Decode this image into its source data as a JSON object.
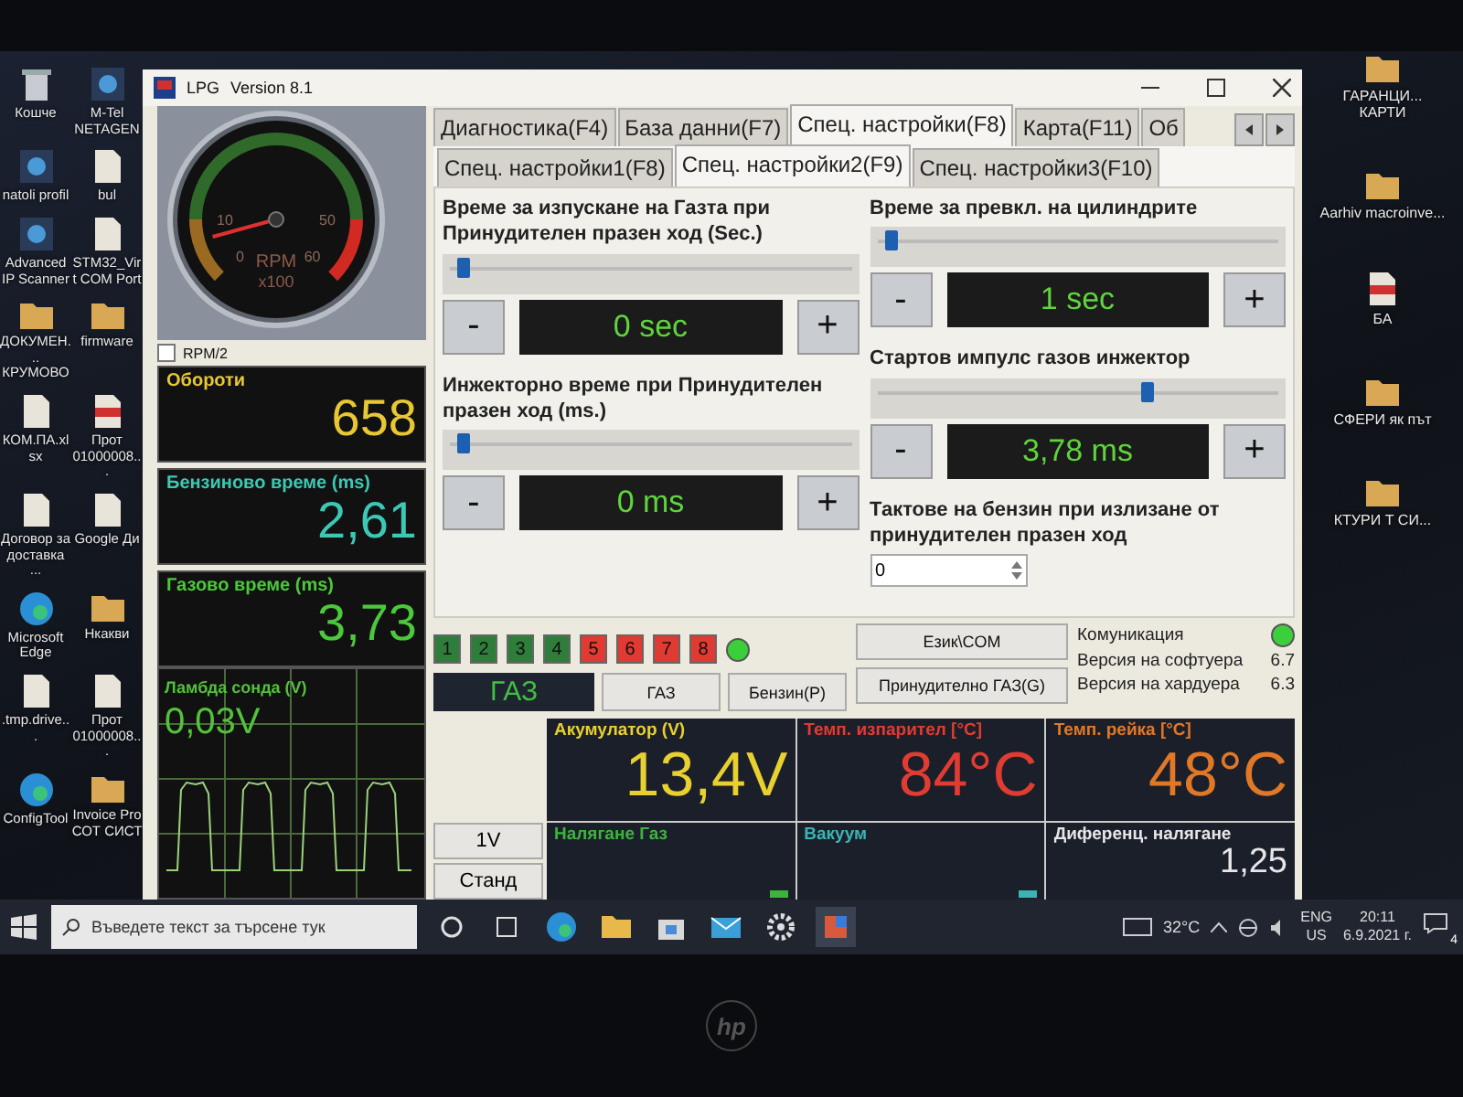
{
  "desktop": {
    "left_icons": [
      {
        "label": "Кошче",
        "kind": "bin"
      },
      {
        "label": "M-Tel NETAGEN",
        "kind": "app"
      },
      {
        "label": "natoli profil",
        "kind": "app"
      },
      {
        "label": "bul",
        "kind": "file"
      },
      {
        "label": "Advanced IP Scanner",
        "kind": "app"
      },
      {
        "label": "STM32_Virt COM Port",
        "kind": "file"
      },
      {
        "label": "ДОКУМЕН... КРУМОВО",
        "kind": "folder"
      },
      {
        "label": "firmware",
        "kind": "folder"
      },
      {
        "label": "КОМ.ПА.xlsx",
        "kind": "file"
      },
      {
        "label": "Прот 01000008...",
        "kind": "pdf"
      },
      {
        "label": "Договор за доставка ...",
        "kind": "file"
      },
      {
        "label": "Google Ди",
        "kind": "file"
      },
      {
        "label": "Microsoft Edge",
        "kind": "edge"
      },
      {
        "label": "Нкакви",
        "kind": "folder"
      },
      {
        "label": ".tmp.drive...",
        "kind": "file"
      },
      {
        "label": "Прот 01000008...",
        "kind": "file"
      },
      {
        "label": "ConfigTool",
        "kind": "edge"
      },
      {
        "label": "Invoice Pro СОТ СИСТ",
        "kind": "folder"
      }
    ],
    "right_icons": [
      {
        "label": "ГАРАНЦИ... КАРТИ",
        "kind": "folder"
      },
      {
        "label": "Aarhiv macroinve...",
        "kind": "folder"
      },
      {
        "label": "БА",
        "kind": "pdf"
      },
      {
        "label": "СФЕРИ як път",
        "kind": "folder"
      },
      {
        "label": "КТУРИ Т СИ...",
        "kind": "folder"
      }
    ]
  },
  "window": {
    "app_label": "LPG",
    "version": "Version 8.1"
  },
  "gauge": {
    "ticks": [
      "0",
      "10",
      "50",
      "60"
    ],
    "unit": "RPM",
    "scale": "x100"
  },
  "rpm_half": {
    "label": "RPM/2",
    "checked": false
  },
  "readouts": [
    {
      "label": "Обороти",
      "value": "658",
      "color": "#e8c832"
    },
    {
      "label": "Бензиново време (ms)",
      "value": "2,61",
      "color": "#3cc8b4"
    },
    {
      "label": "Газово време (ms)",
      "value": "3,73",
      "color": "#4cc83c"
    }
  ],
  "lambda": {
    "label": "Ламбда сонда (V)",
    "value": "0,03V"
  },
  "tabs": [
    {
      "label": "Диагностика(F4)",
      "selected": false
    },
    {
      "label": "База данни(F7)",
      "selected": false
    },
    {
      "label": "Спец. настройки(F8)",
      "selected": true
    },
    {
      "label": "Карта(F11)",
      "selected": false
    },
    {
      "label": "Об",
      "selected": false
    }
  ],
  "subtabs": [
    {
      "label": "Спец. настройки1(F8)",
      "selected": false
    },
    {
      "label": "Спец. настройки2(F9)",
      "selected": true
    },
    {
      "label": "Спец. настройки3(F10)",
      "selected": false
    }
  ],
  "settings": {
    "left": [
      {
        "kind": "slider",
        "title": "Време за изпускане на Газта при Принудителен празен ход (Sec.)",
        "level": 0.03,
        "minus": "-",
        "value": "0 sec",
        "plus": "+"
      },
      {
        "kind": "slider",
        "title": "Инжекторно време при Принудителен празен ход (ms.)",
        "level": 0.03,
        "minus": "-",
        "value": "0 ms",
        "plus": "+"
      }
    ],
    "right": [
      {
        "kind": "slider",
        "title": "Време за превкл. на цилиндрите",
        "level": 0.03,
        "minus": "-",
        "value": "1 sec",
        "plus": "+"
      },
      {
        "kind": "slider",
        "title": "Стартов импулс газов инжектор",
        "level": 0.68,
        "minus": "-",
        "value": "3,78 ms",
        "plus": "+"
      },
      {
        "kind": "spin",
        "title": "Тактове на бензин при излизане от принудителен празен ход",
        "value": "0"
      }
    ]
  },
  "cylinders": [
    {
      "label": "1",
      "color": "#2e7d3a"
    },
    {
      "label": "2",
      "color": "#2e7d3a"
    },
    {
      "label": "3",
      "color": "#2e7d3a"
    },
    {
      "label": "4",
      "color": "#2e7d3a"
    },
    {
      "label": "5",
      "color": "#e03a32"
    },
    {
      "label": "6",
      "color": "#e03a32"
    },
    {
      "label": "7",
      "color": "#e03a32"
    },
    {
      "label": "8",
      "color": "#e03a32"
    }
  ],
  "cylinder_led": {
    "on": true
  },
  "fuel_mode": {
    "display": "ГАЗ"
  },
  "language_button": "Език\\COM",
  "mode_buttons": [
    {
      "label": "ГАЗ"
    },
    {
      "label": "Бензин(P)"
    },
    {
      "label": "Принудително ГАЗ(G)"
    }
  ],
  "info": {
    "communication": {
      "label": "Комуникация",
      "on": true
    },
    "rows": [
      {
        "label": "Версия на софтуера",
        "value": "6.7"
      },
      {
        "label": "Версия на хардуера",
        "value": "6.3"
      }
    ]
  },
  "side_buttons": [
    "1V",
    "Станд"
  ],
  "tiles": [
    {
      "label": "Акумулатор (V)",
      "value": "13,4V",
      "color": "#e8d030"
    },
    {
      "label": "Темп. изпарител [°C]",
      "value": "84°C",
      "color": "#e03c32"
    },
    {
      "label": "Темп. рейка [°C]",
      "value": "48°C",
      "color": "#e07828"
    },
    {
      "label": "Налягане Газ",
      "color": "#3cb43c"
    },
    {
      "label": "Вакуум",
      "color": "#3cb4b4"
    },
    {
      "label": "Диференц. налягане",
      "value": "1,25",
      "color": "#e6e6e6"
    }
  ],
  "taskbar": {
    "search_placeholder": "Въведете текст за търсене тук",
    "weather": "32°C",
    "language": [
      "ENG",
      "US"
    ],
    "time": "20:11",
    "date": "6.9.2021 г.",
    "notifications": "4"
  },
  "bezel": {
    "logo": "hp"
  }
}
